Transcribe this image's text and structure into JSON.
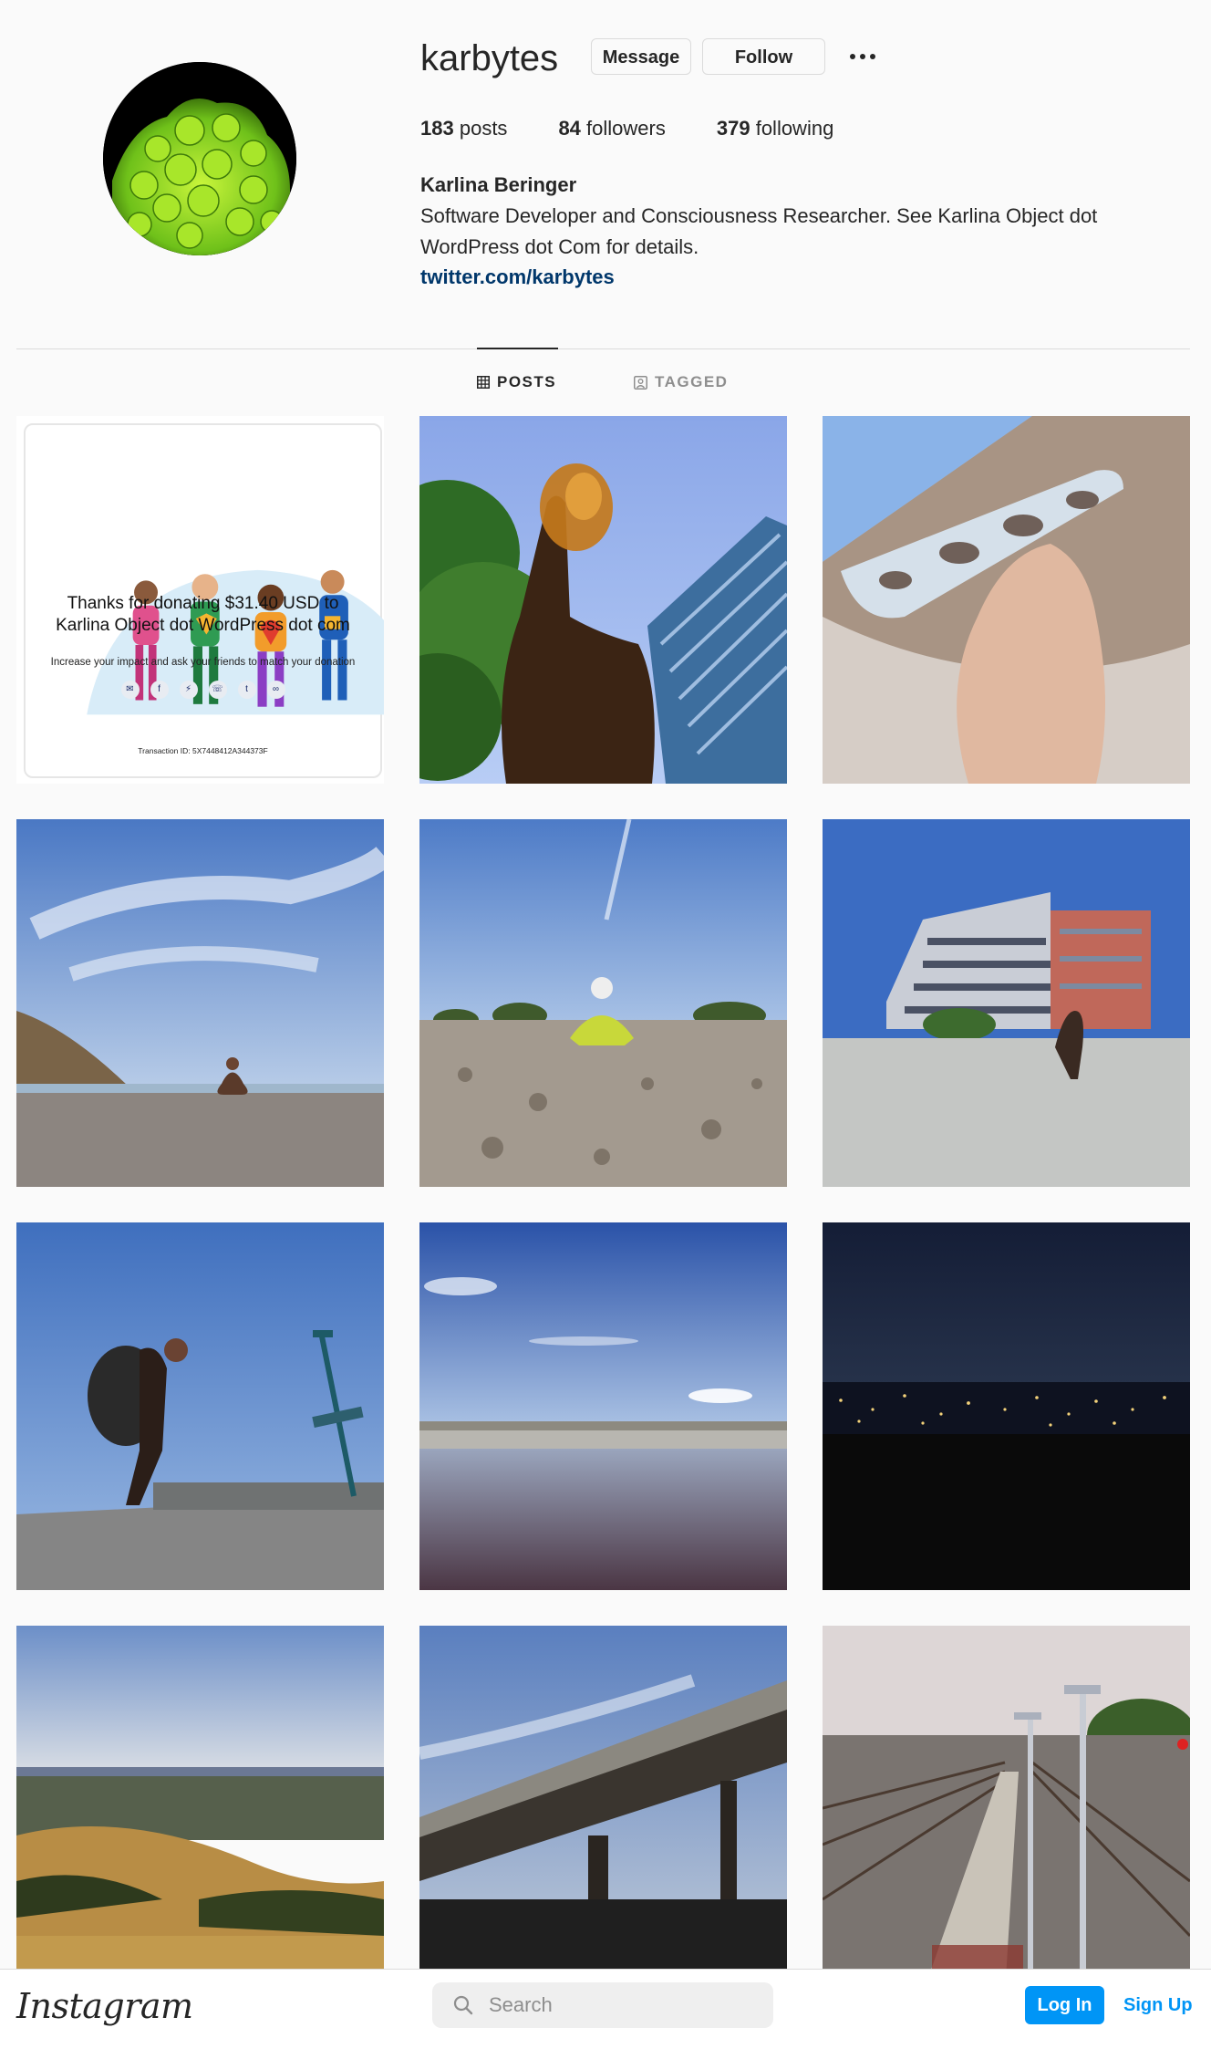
{
  "profile": {
    "username": "karbytes",
    "message_label": "Message",
    "follow_label": "Follow",
    "posts_count": "183",
    "posts_label": "posts",
    "followers_count": "84",
    "followers_label": "followers",
    "following_count": "379",
    "following_label": "following",
    "full_name": "Karlina Beringer",
    "bio": "Software Developer and Consciousness Researcher. See Karlina Object dot WordPress dot Com for details.",
    "link": "twitter.com/karbytes"
  },
  "tabs": [
    {
      "label": "POSTS",
      "active": true,
      "icon": "grid-icon"
    },
    {
      "label": "TAGGED",
      "active": false,
      "icon": "tagged-icon"
    }
  ],
  "donation_card": {
    "title_line1": "Thanks for donating $31.40 USD to",
    "title_line2": "Karlina Object dot WordPress dot com",
    "subtitle": "Increase your impact and ask your friends to match your donation",
    "share_icons": [
      "email-icon",
      "facebook-icon",
      "messenger-icon",
      "whatsapp-icon",
      "twitter-icon",
      "link-icon"
    ],
    "transaction": "Transaction ID: 5X7448412A344373F"
  },
  "posts": [
    {
      "scene": "donation-receipt"
    },
    {
      "scene": "hand-holding-amber-glass-sky"
    },
    {
      "scene": "hand-holding-glass-pipe-beach"
    },
    {
      "scene": "person-meditating-on-beach"
    },
    {
      "scene": "person-sitting-on-gravel"
    },
    {
      "scene": "hiker-near-office-building"
    },
    {
      "scene": "hiker-with-backpack-on-overpass"
    },
    {
      "scene": "bay-water-reflection"
    },
    {
      "scene": "city-lights-at-night"
    },
    {
      "scene": "golden-hills-overlook"
    },
    {
      "scene": "train-on-elevated-track"
    },
    {
      "scene": "rail-yard-with-lamps"
    }
  ],
  "bottom_bar": {
    "logo": "Instagram",
    "search_placeholder": "Search",
    "login_label": "Log In",
    "signup_label": "Sign Up"
  },
  "colors": {
    "background": "#fafafa",
    "primary_button": "#0095f6",
    "link": "#00376b",
    "divider": "#dbdbdb"
  }
}
